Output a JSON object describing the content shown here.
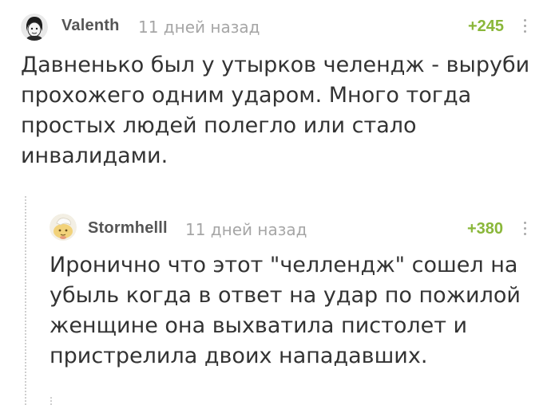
{
  "comments": [
    {
      "author": "Valenth",
      "time": "11 дней назад",
      "rating": "+245",
      "text": "Давненько был у утырков челендж - выруби\nпрохожего одним ударом. Много тогда\nпростых людей полегло или стало\nинвалидами."
    },
    {
      "author": "Stormhelll",
      "time": "11 дней назад",
      "rating": "+380",
      "text": "Иронично что этот \"челлендж\" сошел на\nубыль когда в ответ на удар по пожилой\nженщине она выхватила пистолет и\nпристрелила двоих нападавших."
    }
  ],
  "colors": {
    "rating": "#8ab73a",
    "meta": "#a6a6a6",
    "text": "#333333"
  },
  "icons": [
    "avatar-valenth",
    "avatar-stormhelll",
    "more-dots-icon"
  ]
}
